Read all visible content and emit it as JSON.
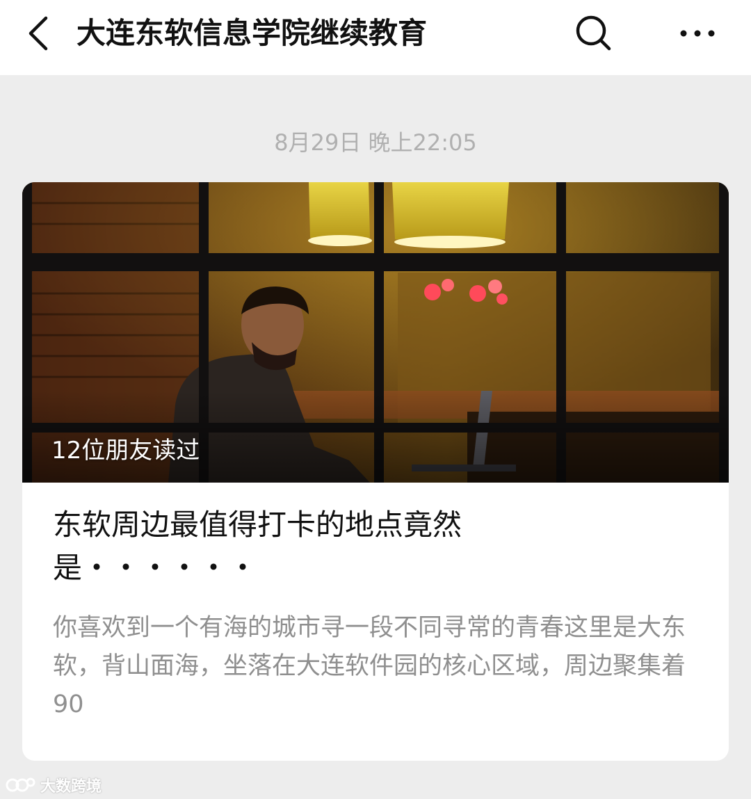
{
  "header": {
    "title": "大连东软信息学院继续教育",
    "back_icon": "back-chevron-icon",
    "search_icon": "search-icon",
    "more_icon": "more-dots-icon"
  },
  "timestamp": "8月29日 晚上22:05",
  "article": {
    "cover_description_icon": "cover-photo",
    "read_count": "12位朋友读过",
    "headline": "东软周边最值得打卡的地点竟然是・・・・・・",
    "summary": "你喜欢到一个有海的城市寻一段不同寻常的青春这里是大东软，背山面海，坐落在大连软件园的核心区域，周边聚集着90"
  },
  "watermark": "大数跨境",
  "colors": {
    "background": "#ededed",
    "header_bg": "#ffffff",
    "timestamp": "#b0b0b0",
    "headline": "#111111",
    "summary": "#8f8f8f"
  }
}
